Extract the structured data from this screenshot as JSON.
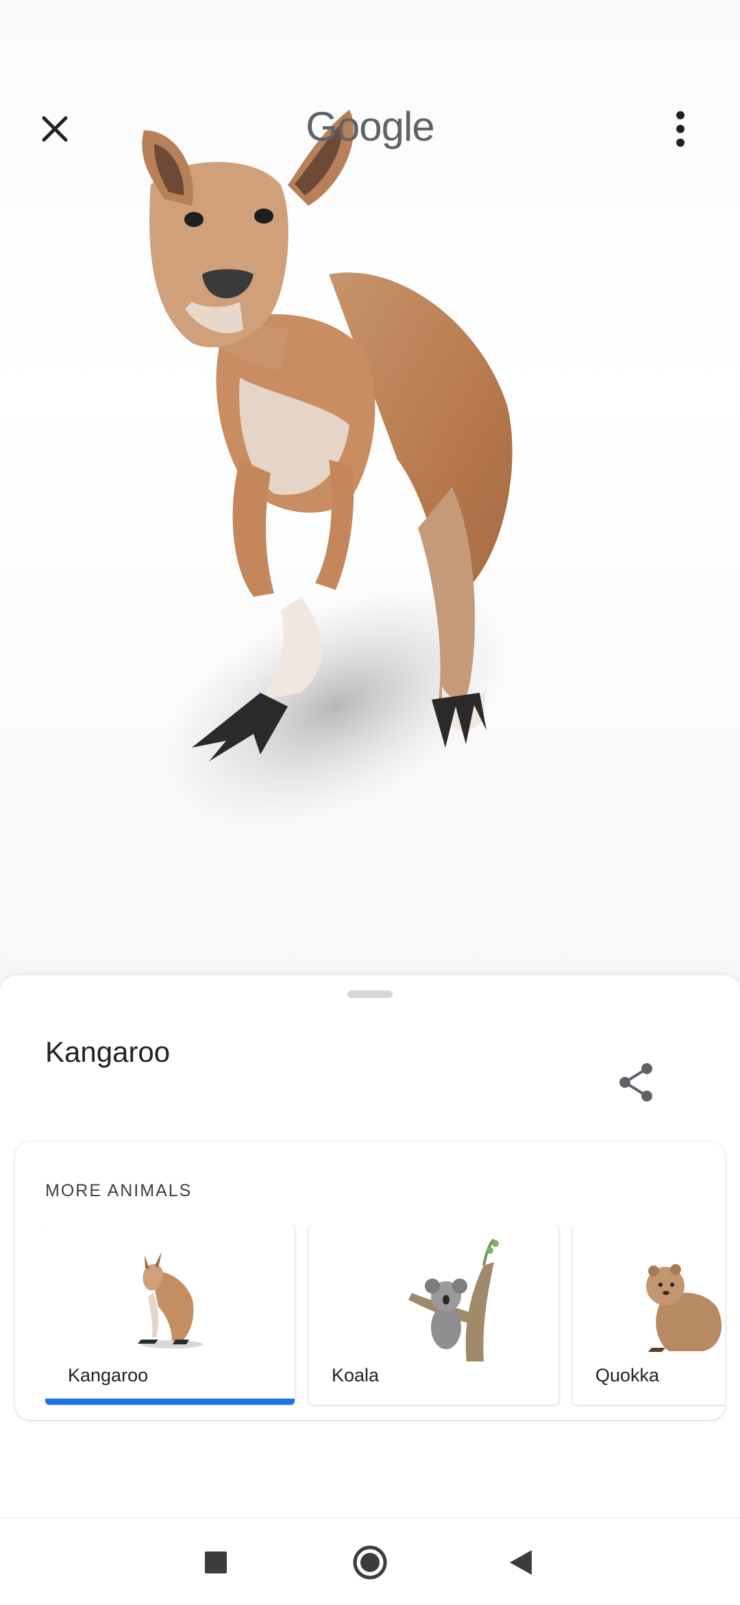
{
  "header": {
    "logo_text": "Google",
    "close_icon": "close-icon",
    "menu_icon": "more-vert-icon"
  },
  "viewer": {
    "model": "kangaroo-3d-model"
  },
  "sheet": {
    "title": "Kangaroo",
    "share_icon": "share-icon",
    "more_section_title": "MORE ANIMALS",
    "animals": [
      {
        "label": "Kangaroo",
        "selected": true
      },
      {
        "label": "Koala",
        "selected": false
      },
      {
        "label": "Quokka",
        "selected": false
      }
    ],
    "selected_color": "#1a73e8"
  },
  "navbar": {
    "recents_icon": "square-icon",
    "home_icon": "circle-icon",
    "back_icon": "triangle-back-icon"
  }
}
